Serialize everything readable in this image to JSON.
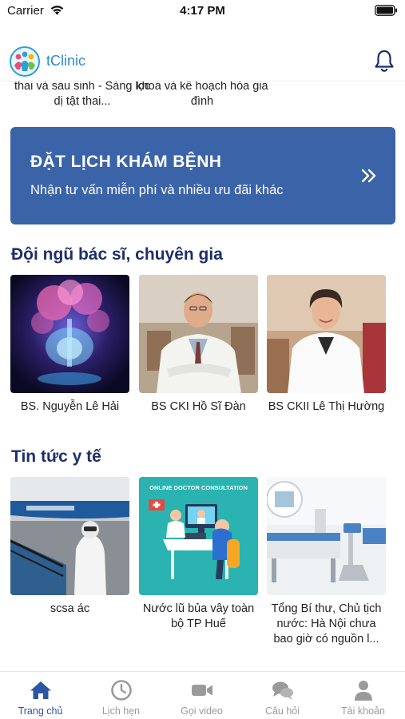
{
  "status_bar": {
    "carrier": "Carrier",
    "time": "4:17 PM"
  },
  "header": {
    "app_name": "tClinic",
    "logo_icon": "family-logo-icon",
    "bell_icon": "bell-icon"
  },
  "services_partial": [
    {
      "text": "thai và sau sinh - Sàng lọc dị tật thai..."
    },
    {
      "text": "khoa và kế hoạch hóa gia đình"
    }
  ],
  "booking": {
    "title": "ĐẶT LỊCH KHÁM BỆNH",
    "subtitle": "Nhận tư vấn miễn phí và nhiều ưu đãi khác",
    "arrow_icon": "double-chevron-right-icon",
    "color": "#3b63a8"
  },
  "doctors": {
    "title": "Đội ngũ bác sĩ, chuyên gia",
    "items": [
      {
        "name": "BS. Nguyễn Lê Hải"
      },
      {
        "name": "BS CKI Hồ Sĩ Đàn"
      },
      {
        "name": "BS CKII Lê Thị Hường"
      }
    ]
  },
  "news": {
    "title": "Tin tức y tế",
    "items": [
      {
        "title": "scsa ác"
      },
      {
        "title": "Nước lũ bủa vây toàn bộ TP Huế",
        "image_text": "ONLINE DOCTOR CONSULTATION"
      },
      {
        "title": "Tổng Bí thư, Chủ tịch nước: Hà Nội chưa bao giờ có nguồn l..."
      }
    ]
  },
  "tabs": [
    {
      "label": "Trang chủ",
      "icon": "home-icon",
      "active": true
    },
    {
      "label": "Lịch hẹn",
      "icon": "clock-icon",
      "active": false
    },
    {
      "label": "Gọi video",
      "icon": "video-camera-icon",
      "active": false
    },
    {
      "label": "Câu hỏi",
      "icon": "chat-bubbles-icon",
      "active": false
    },
    {
      "label": "Tài khoản",
      "icon": "user-icon",
      "active": false
    }
  ],
  "colors": {
    "title_navy": "#1d2f6b",
    "tab_active": "#2c56a3",
    "tab_inactive": "#9a9a9a",
    "brand_blue": "#2c8bd6"
  }
}
